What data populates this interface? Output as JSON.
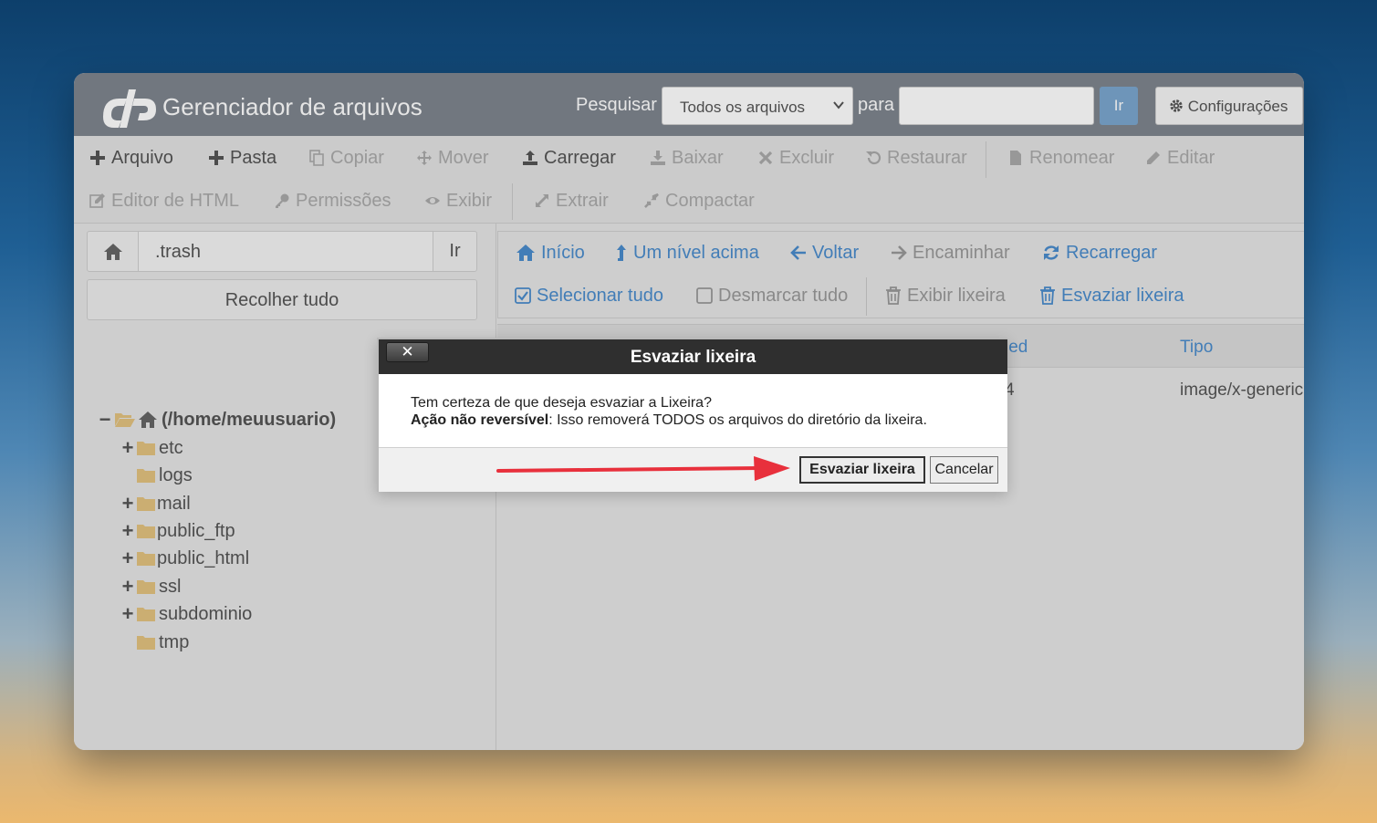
{
  "header": {
    "app_title": "Gerenciador de arquivos",
    "search_label": "Pesquisar",
    "search_scope": "Todos os arquivos",
    "para_label": "para",
    "search_value": "",
    "go_label": "Ir",
    "settings_label": "Configurações"
  },
  "toolbar": {
    "arquivo": "Arquivo",
    "pasta": "Pasta",
    "copiar": "Copiar",
    "mover": "Mover",
    "carregar": "Carregar",
    "baixar": "Baixar",
    "excluir": "Excluir",
    "restaurar": "Restaurar",
    "renomear": "Renomear",
    "editar": "Editar",
    "editor_html": "Editor de HTML",
    "permissoes": "Permissões",
    "exibir": "Exibir",
    "extrair": "Extrair",
    "compactar": "Compactar"
  },
  "left": {
    "path_value": ".trash",
    "path_go": "Ir",
    "collapse_all": "Recolher tudo",
    "tree_root": "(/home/meuusuario)",
    "tree": [
      "etc",
      "logs",
      "mail",
      "public_ftp",
      "public_html",
      "ssl",
      "subdominio",
      "tmp"
    ]
  },
  "nav": {
    "inicio": "Início",
    "nivel_acima": "Um nível acima",
    "voltar": "Voltar",
    "encaminhar": "Encaminhar",
    "recarregar": "Recarregar",
    "selecionar_tudo": "Selecionar tudo",
    "desmarcar_tudo": "Desmarcar tudo",
    "exibir_lixeira": "Exibir lixeira",
    "esvaziar_lixeira": "Esvaziar lixeira"
  },
  "table": {
    "col_modified_partial": "ied",
    "col_tipo": "Tipo",
    "row_date_partial": "4",
    "row_tipo": "image/x-generic"
  },
  "dialog": {
    "title": "Esvaziar lixeira",
    "close": "✕",
    "message": "Tem certeza de que deseja esvaziar a Lixeira?",
    "warning_bold": "Ação não reversível",
    "warning_rest": ": Isso removerá TODOS os arquivos do diretório da lixeira.",
    "confirm": "Esvaziar lixeira",
    "cancel": "Cancelar"
  },
  "colors": {
    "header_bg": "#7e858e",
    "link_blue": "#4a8ccc",
    "folder": "#e3c27f",
    "arrow_red": "#e8303c"
  }
}
